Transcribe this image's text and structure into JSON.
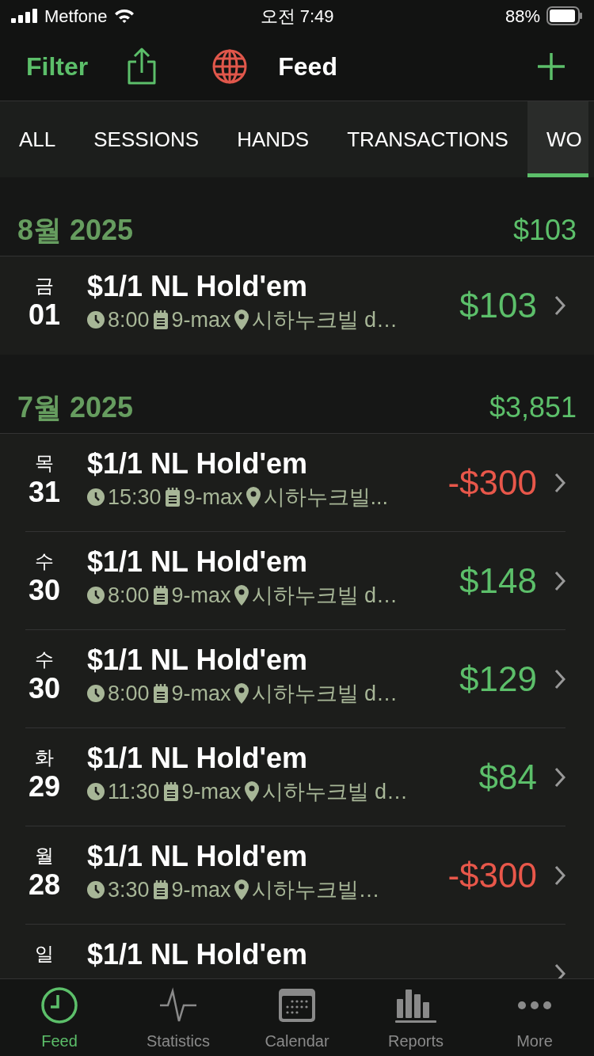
{
  "status_bar": {
    "carrier": "Metfone",
    "time": "오전 7:49",
    "battery": "88%"
  },
  "nav": {
    "filter": "Filter",
    "title": "Feed"
  },
  "tabs": [
    {
      "label": "ALL",
      "selected": false
    },
    {
      "label": "SESSIONS",
      "selected": false
    },
    {
      "label": "HANDS",
      "selected": false
    },
    {
      "label": "TRANSACTIONS",
      "selected": false
    },
    {
      "label": "WO",
      "selected": true
    }
  ],
  "sections": [
    {
      "title": "8월 2025",
      "total": "$103",
      "sessions": [
        {
          "weekday": "금",
          "day": "01",
          "title": "$1/1 NL Hold'em",
          "time": "8:00",
          "table": "9-max",
          "location": "시하누크빌 d…",
          "amount": "$103",
          "negative": false
        }
      ]
    },
    {
      "title": "7월 2025",
      "total": "$3,851",
      "sessions": [
        {
          "weekday": "목",
          "day": "31",
          "title": "$1/1 NL Hold'em",
          "time": "15:30",
          "table": "9-max",
          "location": "시하누크빌...",
          "amount": "-$300",
          "negative": true
        },
        {
          "weekday": "수",
          "day": "30",
          "title": "$1/1 NL Hold'em",
          "time": "8:00",
          "table": "9-max",
          "location": "시하누크빌 d…",
          "amount": "$148",
          "negative": false
        },
        {
          "weekday": "수",
          "day": "30",
          "title": "$1/1 NL Hold'em",
          "time": "8:00",
          "table": "9-max",
          "location": "시하누크빌 d…",
          "amount": "$129",
          "negative": false
        },
        {
          "weekday": "화",
          "day": "29",
          "title": "$1/1 NL Hold'em",
          "time": "11:30",
          "table": "9-max",
          "location": "시하누크빌 d…",
          "amount": "$84",
          "negative": false
        },
        {
          "weekday": "월",
          "day": "28",
          "title": "$1/1 NL Hold'em",
          "time": "3:30",
          "table": "9-max",
          "location": "시하누크빌…",
          "amount": "-$300",
          "negative": true
        },
        {
          "weekday": "일",
          "title": "$1/1 NL Hold'em"
        }
      ]
    }
  ],
  "tab_bar": [
    {
      "label": "Feed",
      "kind": "feed",
      "selected": true
    },
    {
      "label": "Statistics",
      "kind": "statistics",
      "selected": false
    },
    {
      "label": "Calendar",
      "kind": "calendar",
      "selected": false
    },
    {
      "label": "Reports",
      "kind": "reports",
      "selected": false
    },
    {
      "label": "More",
      "kind": "more",
      "selected": false
    }
  ]
}
